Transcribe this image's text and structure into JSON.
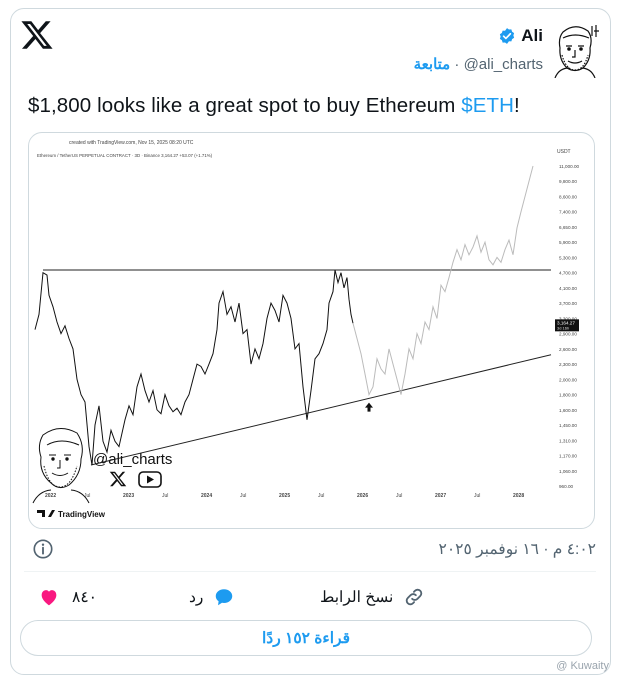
{
  "author": {
    "name": "Ali",
    "handle": "@ali_charts",
    "follow_label": "متابعة",
    "separator": "·"
  },
  "tweet": {
    "text_before": "$1,800 looks like a great spot to buy Ethereum ",
    "cashtag": "$ETH",
    "text_after": "!"
  },
  "chart": {
    "created_with": "created with TradingView.com, Nov 15, 2025 08:20 UTC",
    "symbol_line": "Ethereum / TetherUS PERPETUAL CONTRACT · 3D · Binance  3,164.27  +53.07 (+1.71%)",
    "currency": "USDT",
    "price_ticks": [
      "11,000.00",
      "9,800.00",
      "8,600.00",
      "7,400.00",
      "6,650.00",
      "5,900.00",
      "5,300.00",
      "4,700.00",
      "4,100.00",
      "3,700.00",
      "3,300.00",
      "2,900.00",
      "2,600.00",
      "2,300.00",
      "2,000.00",
      "1,800.00",
      "1,600.00",
      "1,450.00",
      "1,310.00",
      "1,170.00",
      "1,060.00",
      "960.00"
    ],
    "price_label": "3,164.27",
    "price_sublabel": "3d 16h",
    "time_ticks": [
      "2022",
      "Jul",
      "2023",
      "Jul",
      "2024",
      "Jul",
      "2025",
      "Jul",
      "2026",
      "Jul",
      "2027",
      "Jul",
      "2028"
    ],
    "watermark_handle": "@ali_charts",
    "footer_brand": "TradingView",
    "resistance_price": 4800,
    "support_from_price": 1100,
    "support_to_price": 2480,
    "target_price": 1800
  },
  "meta": {
    "timestamp": "٤:٠٢ م · ١٦ نوفمبر ٢٠٢٥"
  },
  "actions": {
    "likes": "٨٤٠",
    "reply_label": "رد",
    "copy_link_label": "نسخ الرابط"
  },
  "read_replies": "قراءة ١٥٢ ردًا",
  "watermark": "@ Kuwaity"
}
